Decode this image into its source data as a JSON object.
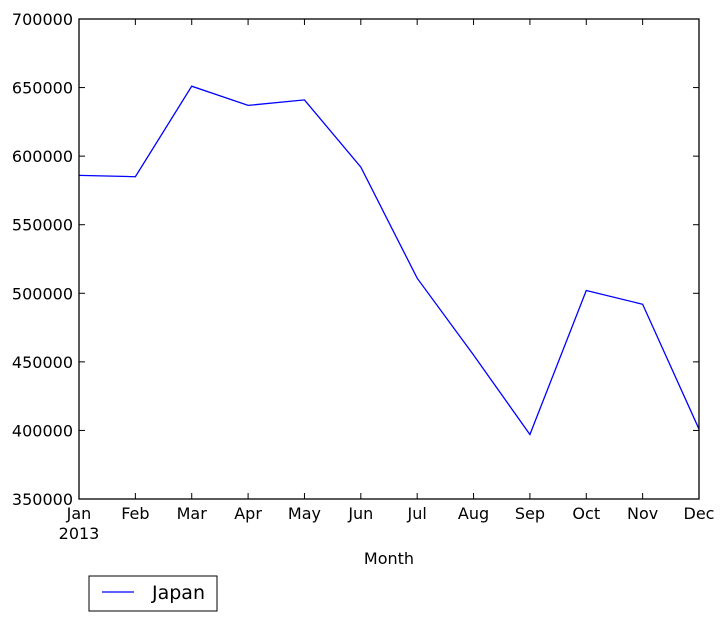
{
  "chart_data": {
    "type": "line",
    "title": "",
    "xlabel": "Month",
    "ylabel": "",
    "x_year_label": "2013",
    "categories": [
      "Jan",
      "Feb",
      "Mar",
      "Apr",
      "May",
      "Jun",
      "Jul",
      "Aug",
      "Sep",
      "Oct",
      "Nov",
      "Dec"
    ],
    "series": [
      {
        "name": "Japan",
        "color": "#0000ff",
        "values": [
          586000,
          585000,
          651000,
          637000,
          641000,
          592000,
          511000,
          455000,
          397000,
          502000,
          492000,
          401000
        ]
      }
    ],
    "ylim": [
      350000,
      700000
    ],
    "yticks": [
      350000,
      400000,
      450000,
      500000,
      550000,
      600000,
      650000,
      700000
    ],
    "ytick_labels": [
      "350000",
      "400000",
      "450000",
      "500000",
      "550000",
      "600000",
      "650000",
      "700000"
    ],
    "grid": false,
    "legend": {
      "placement": "bottom-left-outside",
      "entries": [
        "Japan"
      ]
    }
  }
}
